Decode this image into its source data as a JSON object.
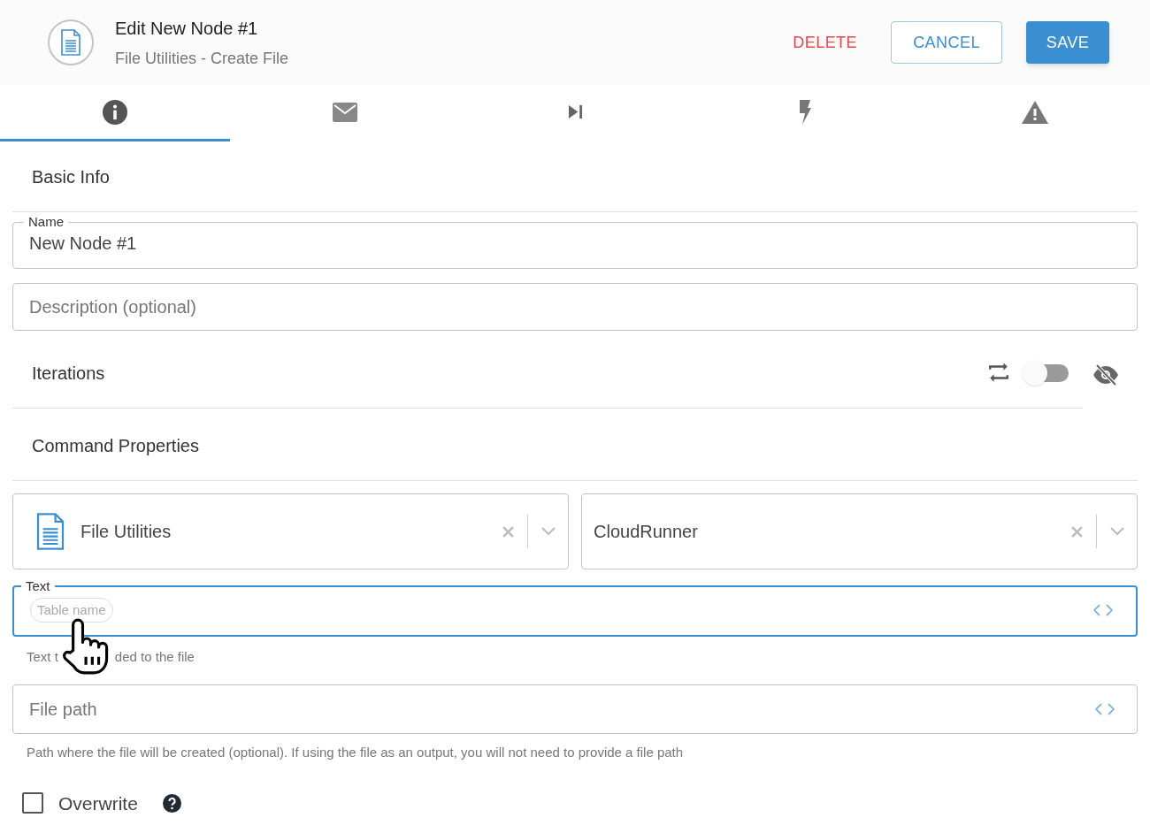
{
  "header": {
    "title": "Edit New Node #1",
    "subtitle": "File Utilities - Create File",
    "buttons": [
      {
        "label": "DELETE",
        "kind": "danger"
      },
      {
        "label": "CANCEL",
        "kind": "outline"
      },
      {
        "label": "SAVE",
        "kind": "primary"
      }
    ]
  },
  "tabs": [
    {
      "selected": true
    },
    {
      "selected": false
    },
    {
      "selected": false
    },
    {
      "selected": false
    },
    {
      "selected": false
    }
  ],
  "basic_info": {
    "heading": "Basic Info",
    "name_field": {
      "label": "Name",
      "value": "New Node #1"
    },
    "description_field": {
      "placeholder": "Description (optional)"
    }
  },
  "iterations": {
    "heading": "Iterations",
    "on": false
  },
  "command_properties": {
    "heading": "Command Properties",
    "selects": [
      {
        "value": "File Utilities"
      },
      {
        "value": "CloudRunner"
      }
    ],
    "text_field": {
      "label": "Text",
      "chip": "Table name",
      "focused": true,
      "helper_parts": [
        "Text t",
        "ded to the file"
      ]
    },
    "file_path_field": {
      "placeholder": "File path",
      "focused": false,
      "helper": "Path where the file will be created (optional). If using the file as an output, you will not need to provide a file path"
    },
    "overwrite": {
      "label": "Overwrite",
      "checked": false
    }
  }
}
